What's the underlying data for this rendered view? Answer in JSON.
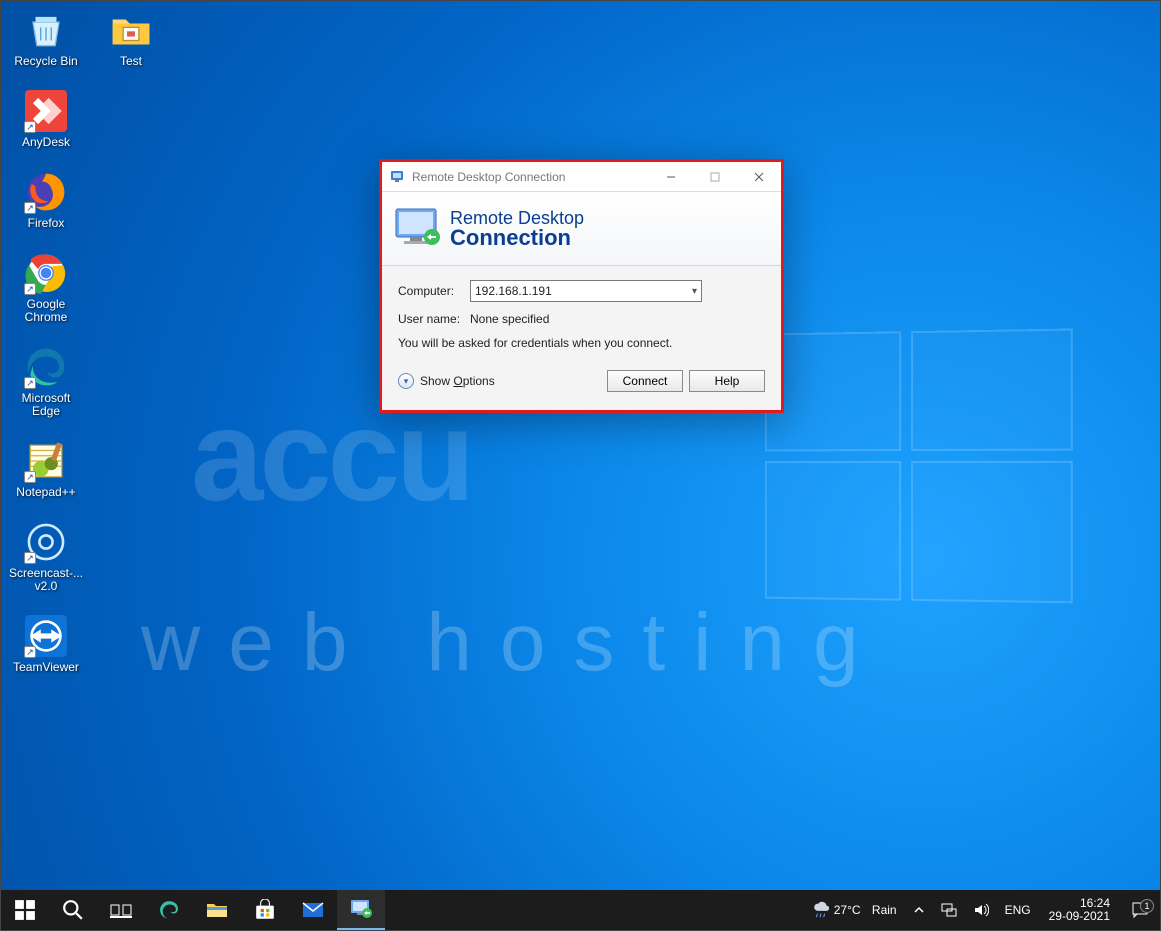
{
  "desktop": {
    "icons_col1": [
      {
        "label": "Recycle Bin",
        "shortcut": false
      },
      {
        "label": "AnyDesk",
        "shortcut": true
      },
      {
        "label": "Firefox",
        "shortcut": true
      },
      {
        "label": "Google Chrome",
        "shortcut": true
      },
      {
        "label": "Microsoft Edge",
        "shortcut": true
      },
      {
        "label": "Notepad++",
        "shortcut": true
      },
      {
        "label": "Screencast-... v2.0",
        "shortcut": true
      },
      {
        "label": "TeamViewer",
        "shortcut": true
      }
    ],
    "icons_col2": [
      {
        "label": "Test",
        "shortcut": false
      }
    ]
  },
  "rdc": {
    "window_title": "Remote Desktop Connection",
    "banner_line1": "Remote Desktop",
    "banner_line2": "Connection",
    "computer_label": "Computer:",
    "computer_value": "192.168.1.191",
    "username_label": "User name:",
    "username_value": "None specified",
    "hint": "You will be asked for credentials when you connect.",
    "show_options_prefix": "Show ",
    "show_options_key": "O",
    "show_options_suffix": "ptions",
    "connect": "Connect",
    "help": "Help"
  },
  "taskbar": {
    "weather_temp": "27°C",
    "weather_cond": "Rain",
    "lang": "ENG",
    "time": "16:24",
    "date": "29-09-2021",
    "notif_count": "1"
  },
  "watermark": {
    "top": "accu",
    "bottom": "web hosting"
  }
}
